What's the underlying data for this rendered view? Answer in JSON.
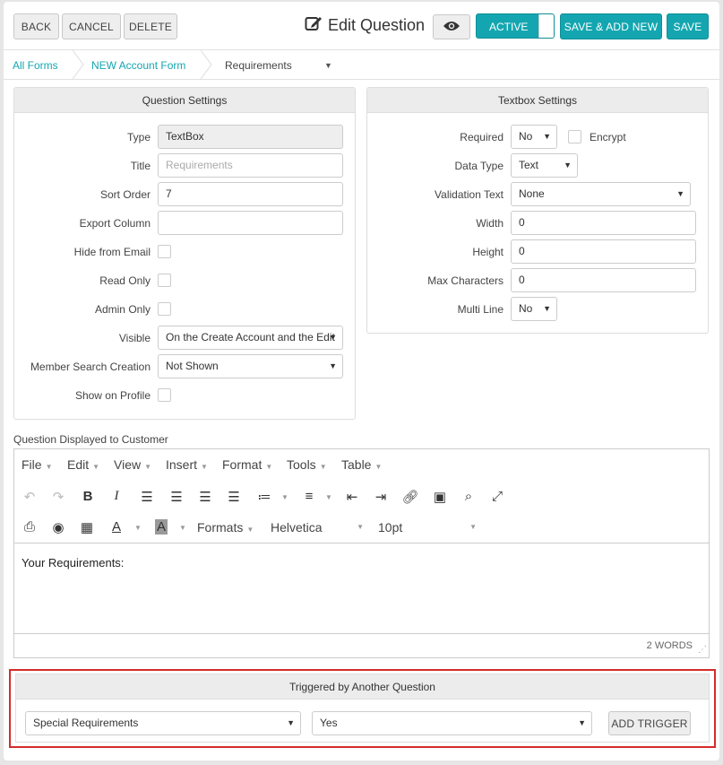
{
  "toolbar": {
    "back": "BACK",
    "cancel": "CANCEL",
    "delete": "DELETE",
    "title": "Edit Question",
    "active": "ACTIVE",
    "save_new": "SAVE & ADD NEW",
    "save": "SAVE"
  },
  "breadcrumb": {
    "items": [
      "All Forms",
      "NEW Account Form",
      "Requirements"
    ]
  },
  "question_settings": {
    "heading": "Question Settings",
    "type_label": "Type",
    "type_value": "TextBox",
    "title_label": "Title",
    "title_placeholder": "Requirements",
    "sort_label": "Sort Order",
    "sort_value": "7",
    "export_label": "Export Column",
    "export_value": "",
    "hide_email_label": "Hide from Email",
    "read_only_label": "Read Only",
    "admin_only_label": "Admin Only",
    "visible_label": "Visible",
    "visible_value": "On the Create Account and the Edit",
    "member_search_label": "Member Search Creation",
    "member_search_value": "Not Shown",
    "show_profile_label": "Show on Profile"
  },
  "textbox_settings": {
    "heading": "Textbox Settings",
    "required_label": "Required",
    "required_value": "No",
    "encrypt_label": "Encrypt",
    "data_type_label": "Data Type",
    "data_type_value": "Text",
    "validation_label": "Validation Text",
    "validation_value": "None",
    "width_label": "Width",
    "width_value": "0",
    "height_label": "Height",
    "height_value": "0",
    "max_label": "Max Characters",
    "max_value": "0",
    "multiline_label": "Multi Line",
    "multiline_value": "No"
  },
  "editor": {
    "label": "Question Displayed to Customer",
    "menus": [
      "File",
      "Edit",
      "View",
      "Insert",
      "Format",
      "Tools",
      "Table"
    ],
    "formats": "Formats",
    "font": "Helvetica",
    "size": "10pt",
    "content": "Your Requirements:",
    "word_count": "2 WORDS"
  },
  "trigger": {
    "heading": "Triggered by Another Question",
    "question_value": "Special Requirements",
    "answer_value": "Yes",
    "add_button": "ADD TRIGGER"
  },
  "colors": {
    "accent": "#14a6b0",
    "highlight": "#d42b2b"
  }
}
